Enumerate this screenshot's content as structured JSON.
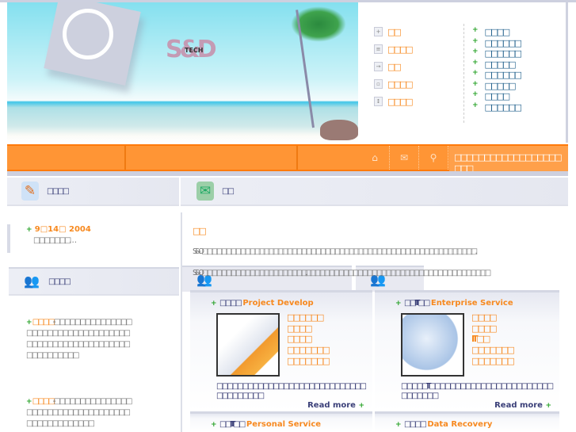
{
  "header": {
    "logo_text": "S&D",
    "logo_sub": "TECH"
  },
  "top_menu": [
    {
      "icon": "home-icon",
      "label": "□□"
    },
    {
      "icon": "document-icon",
      "label": "□□□□"
    },
    {
      "icon": "login-icon",
      "label": "□□"
    },
    {
      "icon": "window-icon",
      "label": "□□□□"
    },
    {
      "icon": "updown-icon",
      "label": "□□□□"
    }
  ],
  "side_links": [
    "□□□□",
    "□□□□□□",
    "□□□□□□",
    "□□□□□",
    "□□□□□□",
    "□□□□□",
    "□□□□",
    "□□□□□□"
  ],
  "navbar": {
    "home": "⌂",
    "mail": "✉",
    "search": "⚲",
    "marquee": "□□□□□□□□□□□□ □□□□□□□□□"
  },
  "left": {
    "news_title": "□□□□",
    "news": [
      {
        "date": "9□14□ 2004",
        "text": "□□□□□□□…"
      }
    ],
    "partners_title": "□□□□",
    "partners": [
      {
        "name": "□□□□",
        "text": "--□□□□□□□□□□□□□□□□□□□□□□□□□□□□□□□□□□□□□□□□□□□□□□□□□□□□□□□□□□□□□□□□□"
      },
      {
        "name": "□□□□",
        "text": "--□□□□□□□□□□□□□□□□□□□□□□□□□□□□□□□□□□□□□□□□□□□□□□□□"
      }
    ]
  },
  "main": {
    "title": "□□",
    "intro_title": "□□",
    "para1": "S&O□□□□□□□□□□□□□□□□□□□□□□□□□□□□□□□□□□□□□□□□□□□□□□□□□□□□□□□□□□.",
    "para2": "S&O□□□□□□□□□□□□□□□□□□□□□□. □□□□□□□□□□□□□□□□□□□□□□□□□□□□□□□□□□□□□□□",
    "cards": [
      {
        "cn": "□□□□",
        "en": "Project Develop",
        "links": [
          "□□□□□□",
          "□□□□",
          "□□□□",
          "□□□□□□□",
          "□□□□□□□"
        ],
        "desc": "□□□□□□□□□□□□□□□□□□□□□□□□□□□□□□□□□□□□□□",
        "more": "Read more"
      },
      {
        "cn": "□□IT□□",
        "en": "Enterprise Service",
        "links": [
          "□□□□",
          "□□□□",
          "IT □□",
          "□□□□□□□",
          "□□□□□□□"
        ],
        "desc": "□□□□□IT□□□□□□□□□□□□□□□□□□□□□□□□□□□□□□□",
        "more": "Read more"
      },
      {
        "cn": "□□IT□□",
        "en": "Personal Service"
      },
      {
        "cn": "□□□□",
        "en": "Data Recovery"
      }
    ]
  }
}
